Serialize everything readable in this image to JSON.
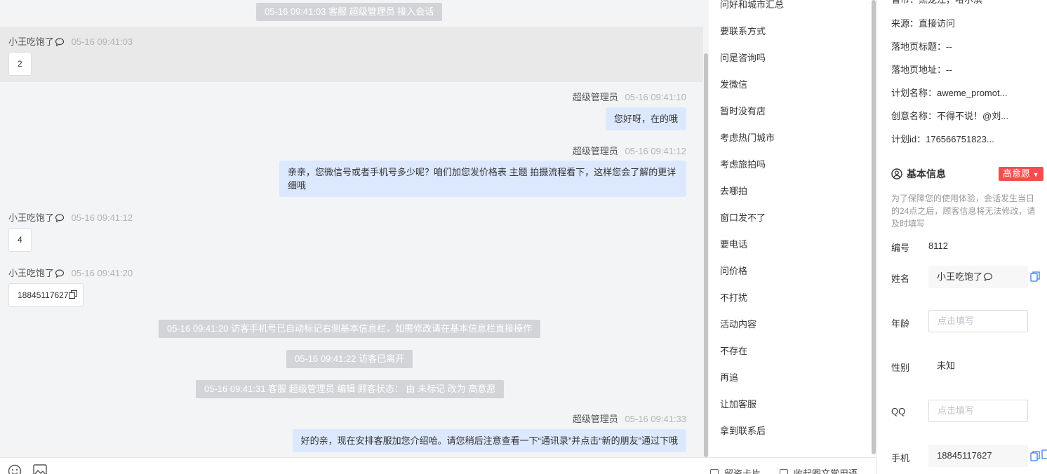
{
  "chat": {
    "messages": [
      {
        "kind": "system",
        "text": "05-16 09:41:03 客服 超级管理员 接入会话"
      },
      {
        "kind": "in",
        "sender": "小王吃饱了",
        "time": "05-16 09:41:03",
        "text": "2"
      },
      {
        "kind": "out",
        "sender": "超级管理员",
        "time": "05-16 09:41:10",
        "text": "您好呀，在的哦"
      },
      {
        "kind": "out",
        "sender": "超级管理员",
        "time": "05-16 09:41:12",
        "text": "亲亲，您微信号或者手机号多少呢？咱们加您发价格表 主题 拍摄流程看下，这样您会了解的更详细哦"
      },
      {
        "kind": "in",
        "sender": "小王吃饱了",
        "time": "05-16 09:41:12",
        "text": "4"
      },
      {
        "kind": "in",
        "sender": "小王吃饱了",
        "time": "05-16 09:41:20",
        "text": "18845117627"
      },
      {
        "kind": "system",
        "text": "05-16 09:41:20 访客手机号已自动标记右侧基本信息栏，如需修改请在基本信息栏直接操作"
      },
      {
        "kind": "system",
        "text": "05-16 09:41:22 访客已离开"
      },
      {
        "kind": "system",
        "text": "05-16 09:41:31 客服 超级管理员 编辑 顾客状态： 由 未标记 改为 高意愿"
      },
      {
        "kind": "out",
        "sender": "超级管理员",
        "time": "05-16 09:41:33",
        "text": "好的亲，现在安排客服加您介绍哈。请您稍后注意查看一下“通讯录”并点击“新的朋友”通过下哦"
      }
    ]
  },
  "toolbar": {
    "emoji_icon": "smile-icon",
    "image_icon": "image-icon",
    "leave_card_label": "留资卡片",
    "collapse_label": "收起图文常用语"
  },
  "quick_replies": [
    "问好和城市汇总",
    "要联系方式",
    "问是咨询吗",
    "发微信",
    "暂时没有店",
    "考虑热门城市",
    "考虑旅拍吗",
    "去哪拍",
    "窗口发不了",
    "要电话",
    "问价格",
    "不打扰",
    "活动内容",
    "不存在",
    "再追",
    "让加客服",
    "拿到联系后"
  ],
  "info": {
    "region": "省市：黑龙江，哈尔滨",
    "source": "来源：直接访问",
    "landing_title": "落地页标题：--",
    "landing_url": "落地页地址：--",
    "plan_name": "计划名称：aweme_promot...",
    "creative_name": "创意名称：不得不说！@刘...",
    "plan_id": "计划id：176566751823..."
  },
  "basic": {
    "title": "基本信息",
    "intent_badge": "高意愿",
    "notice": "为了保障您的使用体验，会话发生当日的24点之后，顾客信息将无法修改，请及时填写",
    "id_label": "编号",
    "id_value": "8112",
    "name_label": "姓名",
    "name_value": "小王吃饱了",
    "age_label": "年龄",
    "age_placeholder": "点击填写",
    "gender_label": "性别",
    "gender_value": "未知",
    "qq_label": "QQ",
    "qq_placeholder": "点击填写",
    "phone_label": "手机",
    "phone_value": "18845117627"
  },
  "colors": {
    "accent_blue": "#3a7bf2",
    "badge_red": "#f24e4e",
    "out_bubble": "#dce8fd",
    "system_pill": "#d3d4d7"
  }
}
